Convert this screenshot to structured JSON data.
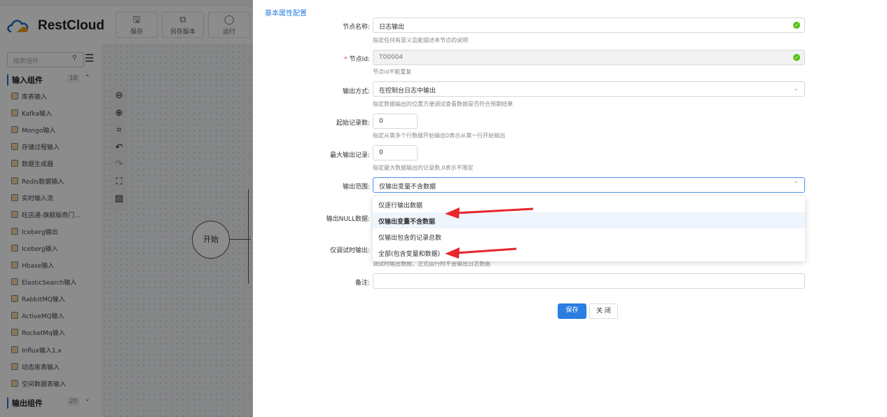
{
  "app": {
    "logo_text": "RestCloud"
  },
  "toolbar": {
    "save": "保存",
    "save_version": "另存版本",
    "run": "运行"
  },
  "sidebar": {
    "search_placeholder": "搜索组件",
    "groups": [
      {
        "label": "输入组件",
        "count": "18"
      },
      {
        "label": "输出组件",
        "count": "20"
      }
    ],
    "items": [
      "库表输入",
      "Kafka输入",
      "Mongo输入",
      "存储过程输入",
      "数据生成器",
      "Redis数据输入",
      "实时输入流",
      "旺店通-旗舰版奇门…",
      "Iceberg输出",
      "Iceberg输入",
      "Hbase输入",
      "ElasticSearch输入",
      "RabbitMQ输入",
      "ActiveMQ输入",
      "RocketMq输入",
      "Influx输入1.x",
      "动态库表输入",
      "空间数据表输入"
    ]
  },
  "canvas": {
    "start_node": "开始"
  },
  "form": {
    "section_title": "基本属性配置",
    "node_name": {
      "label": "节点名称:",
      "value": "日志输出",
      "hint": "指定任何有意义且能描述本节点的说明"
    },
    "node_id": {
      "label": "节点Id:",
      "required": "*",
      "value": "T00004",
      "hint": "节点id不能重复"
    },
    "output_mode": {
      "label": "输出方式:",
      "value": "在控制台日志中输出",
      "hint": "指定数据输出的位置方便调试查看数据是否符合预期结果"
    },
    "start_record": {
      "label": "起始记录数:",
      "value": "0",
      "hint": "指定从第多个行数据开始输出0表示从第一行开始输出"
    },
    "max_record": {
      "label": "最大输出记录:",
      "value": "0",
      "hint": "指定最大数据输出的记录数,0表示不限定"
    },
    "output_scope": {
      "label": "输出范围:",
      "value": "仅输出变量不含数据",
      "options": [
        "仅逐行输出数据",
        "仅输出变量不含数据",
        "仅输出包含的记录总数",
        "全部(包含变量和数据)"
      ]
    },
    "output_null": {
      "label": "输出NULL数据:"
    },
    "debug_only": {
      "label": "仅调试时输出:",
      "hint": "调试时输出数据，正式运行时不会输出日志数据"
    },
    "remark": {
      "label": "备注:",
      "value": ""
    },
    "save": "保存",
    "close": "关 闭"
  },
  "colors": {
    "accent": "#2a7de1",
    "arrow": "#e8262b",
    "success": "#52c41a"
  }
}
